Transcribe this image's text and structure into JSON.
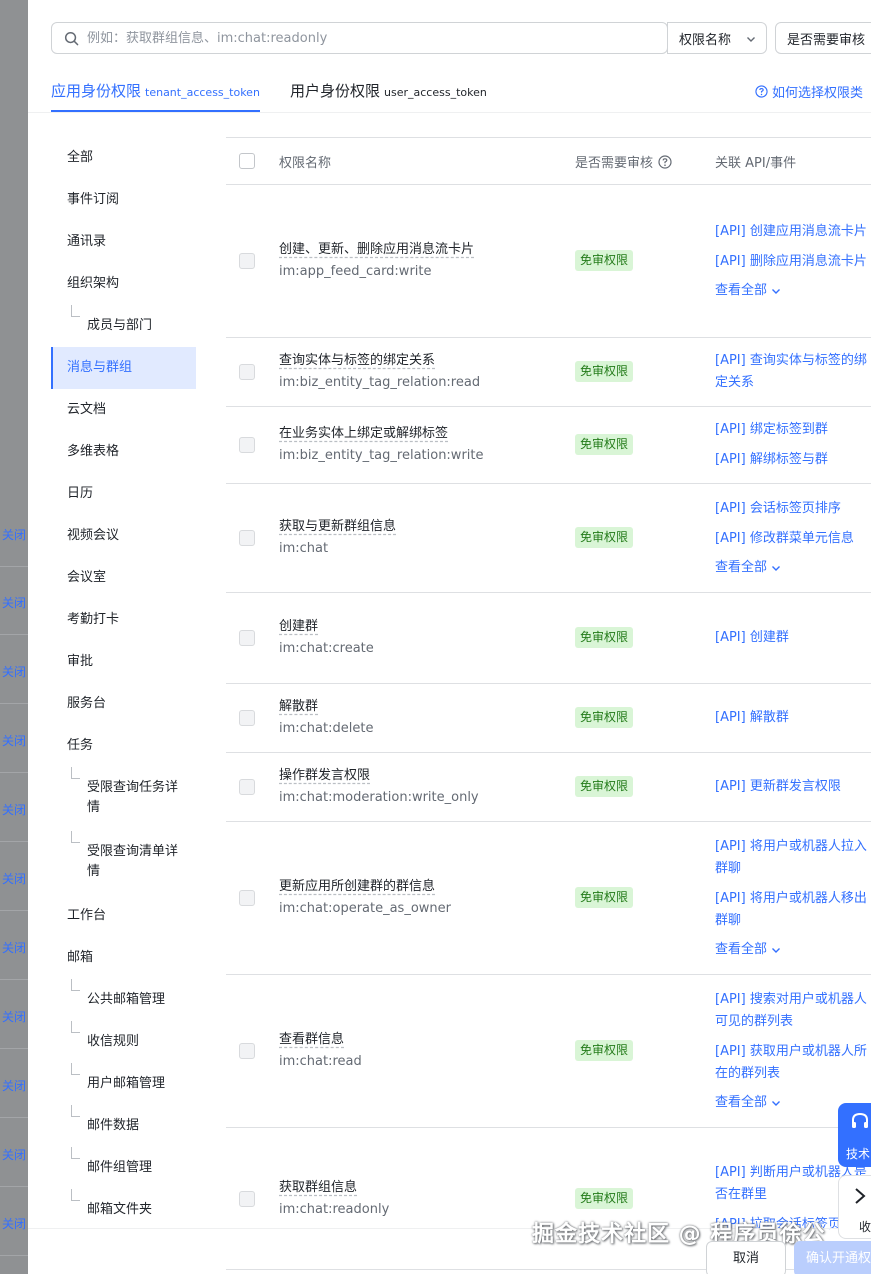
{
  "backdrop": {
    "links": [
      "关闭",
      "关闭",
      "关闭",
      "关闭",
      "关闭",
      "关闭",
      "关闭",
      "关闭",
      "关闭",
      "关闭",
      "关闭"
    ]
  },
  "search": {
    "placeholder": "例如：获取群组信息、im:chat:readonly",
    "icon": "search-icon"
  },
  "filters": {
    "permission_name": "权限名称",
    "need_review": "是否需要审核"
  },
  "tabs": [
    {
      "label": "应用身份权限",
      "token": "tenant_access_token",
      "active": true
    },
    {
      "label": "用户身份权限",
      "token": "user_access_token",
      "active": false
    }
  ],
  "help_link": "如何选择权限类",
  "sidebar": [
    {
      "label": "全部",
      "sub": false
    },
    {
      "label": "事件订阅",
      "sub": false
    },
    {
      "label": "通讯录",
      "sub": false
    },
    {
      "label": "组织架构",
      "sub": false
    },
    {
      "label": "成员与部门",
      "sub": true
    },
    {
      "label": "消息与群组",
      "sub": false,
      "active": true
    },
    {
      "label": "云文档",
      "sub": false
    },
    {
      "label": "多维表格",
      "sub": false
    },
    {
      "label": "日历",
      "sub": false
    },
    {
      "label": "视频会议",
      "sub": false
    },
    {
      "label": "会议室",
      "sub": false
    },
    {
      "label": "考勤打卡",
      "sub": false
    },
    {
      "label": "审批",
      "sub": false
    },
    {
      "label": "服务台",
      "sub": false
    },
    {
      "label": "任务",
      "sub": false
    },
    {
      "label": "受限查询任务详情",
      "sub": true,
      "wrap": true
    },
    {
      "label": "受限查询清单详情",
      "sub": true,
      "wrap": true
    },
    {
      "label": "工作台",
      "sub": false
    },
    {
      "label": "邮箱",
      "sub": false
    },
    {
      "label": "公共邮箱管理",
      "sub": true
    },
    {
      "label": "收信规则",
      "sub": true
    },
    {
      "label": "用户邮箱管理",
      "sub": true
    },
    {
      "label": "邮件数据",
      "sub": true
    },
    {
      "label": "邮件组管理",
      "sub": true
    },
    {
      "label": "邮箱文件夹",
      "sub": true
    }
  ],
  "table": {
    "headers": {
      "name": "权限名称",
      "review": "是否需要审核",
      "api": "关联 API/事件"
    },
    "rows": [
      {
        "name": "创建、更新、删除应用消息流卡片",
        "code": "im:app_feed_card:write",
        "badge": "免审权限",
        "apis": [
          "[API] 创建应用消息流卡片",
          "[API] 删除应用消息流卡片"
        ],
        "more": "查看全部"
      },
      {
        "name": "查询实体与标签的绑定关系",
        "code": "im:biz_entity_tag_relation:read",
        "badge": "免审权限",
        "apis": [
          "[API] 查询实体与标签的绑定关系"
        ]
      },
      {
        "name": "在业务实体上绑定或解绑标签",
        "code": "im:biz_entity_tag_relation:write",
        "badge": "免审权限",
        "apis": [
          "[API] 绑定标签到群",
          "[API] 解绑标签与群"
        ]
      },
      {
        "name": "获取与更新群组信息",
        "code": "im:chat",
        "badge": "免审权限",
        "apis": [
          "[API] 会话标签页排序",
          "[API] 修改群菜单元信息"
        ],
        "more": "查看全部"
      },
      {
        "name": "创建群",
        "code": "im:chat:create",
        "badge": "免审权限",
        "apis": [
          "[API] 创建群"
        ]
      },
      {
        "name": "解散群",
        "code": "im:chat:delete",
        "badge": "免审权限",
        "apis": [
          "[API] 解散群"
        ]
      },
      {
        "name": "操作群发言权限",
        "code": "im:chat:moderation:write_only",
        "badge": "免审权限",
        "apis": [
          "[API] 更新群发言权限"
        ]
      },
      {
        "name": "更新应用所创建群的群信息",
        "code": "im:chat:operate_as_owner",
        "badge": "免审权限",
        "apis": [
          "[API] 将用户或机器人拉入群聊",
          "[API] 将用户或机器人移出群聊"
        ],
        "more": "查看全部"
      },
      {
        "name": "查看群信息",
        "code": "im:chat:read",
        "badge": "免审权限",
        "apis": [
          "[API] 搜索对用户或机器人可见的群列表",
          "[API] 获取用户或机器人所在的群列表"
        ],
        "more": "查看全部"
      },
      {
        "name": "获取群组信息",
        "code": "im:chat:readonly",
        "badge": "免审权限",
        "apis": [
          "[API] 判断用户或机器人是否在群里",
          "[API] 拉取会话标签页"
        ]
      }
    ]
  },
  "float_buttons": {
    "support": "技术",
    "collapse": "收"
  },
  "watermark": "掘金技术社区 @ 程序员徐公",
  "footer": {
    "cancel": "取消",
    "confirm": "确认开通权限"
  }
}
